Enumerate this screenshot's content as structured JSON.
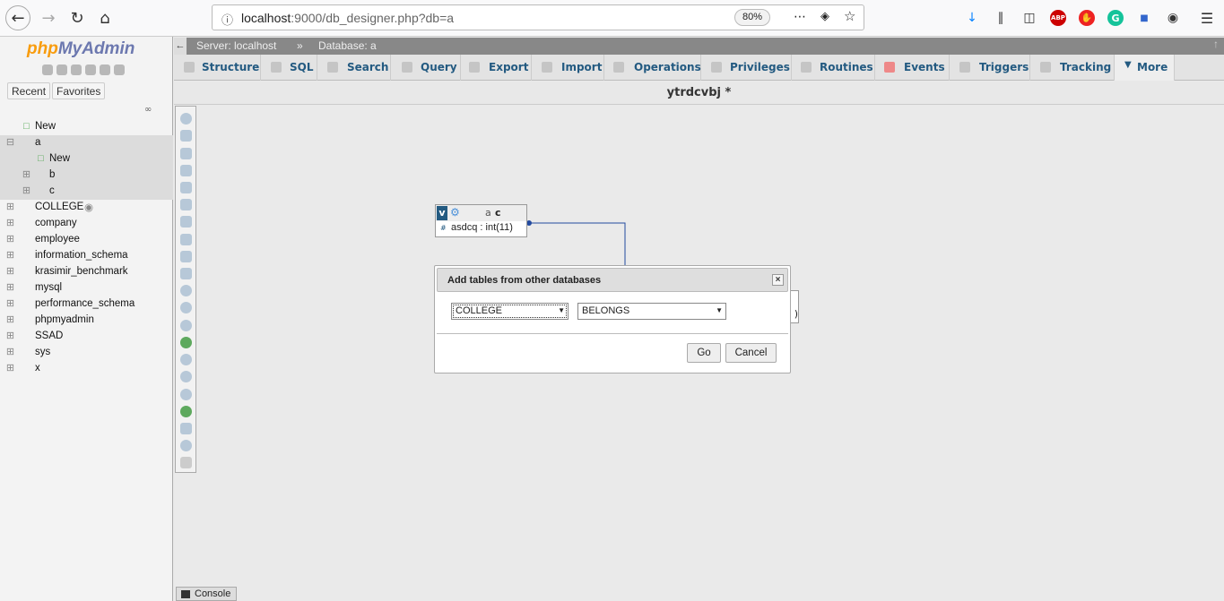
{
  "browser": {
    "url_host": "localhost",
    "url_rest": ":9000/db_designer.php?db=a",
    "zoom": "80%"
  },
  "sidebar": {
    "logo_php": "php",
    "logo_myadmin": "MyAdmin",
    "tab_recent": "Recent",
    "tab_favorites": "Favorites",
    "tree": [
      "New",
      "a",
      "New",
      "b",
      "c",
      "COLLEGE",
      "company",
      "employee",
      "information_schema",
      "krasimir_benchmark",
      "mysql",
      "performance_schema",
      "phpmyadmin",
      "SSAD",
      "sys",
      "x"
    ]
  },
  "breadcrumb": {
    "server": "Server: localhost",
    "sep": "»",
    "database": "Database: a"
  },
  "tabs": [
    "Structure",
    "SQL",
    "Search",
    "Query",
    "Export",
    "Import",
    "Operations",
    "Privileges",
    "Routines",
    "Events",
    "Triggers",
    "Tracking",
    "More"
  ],
  "designer": {
    "title": "ytrdcvbj *",
    "table_v": "v",
    "table_db": "a",
    "table_name": "c",
    "column": "asdcq : int(11)"
  },
  "dialog": {
    "title": "Add tables from other databases",
    "db_select": "COLLEGE",
    "table_select": "BELONGS",
    "go": "Go",
    "cancel": "Cancel",
    "close": "×"
  },
  "console": "Console"
}
